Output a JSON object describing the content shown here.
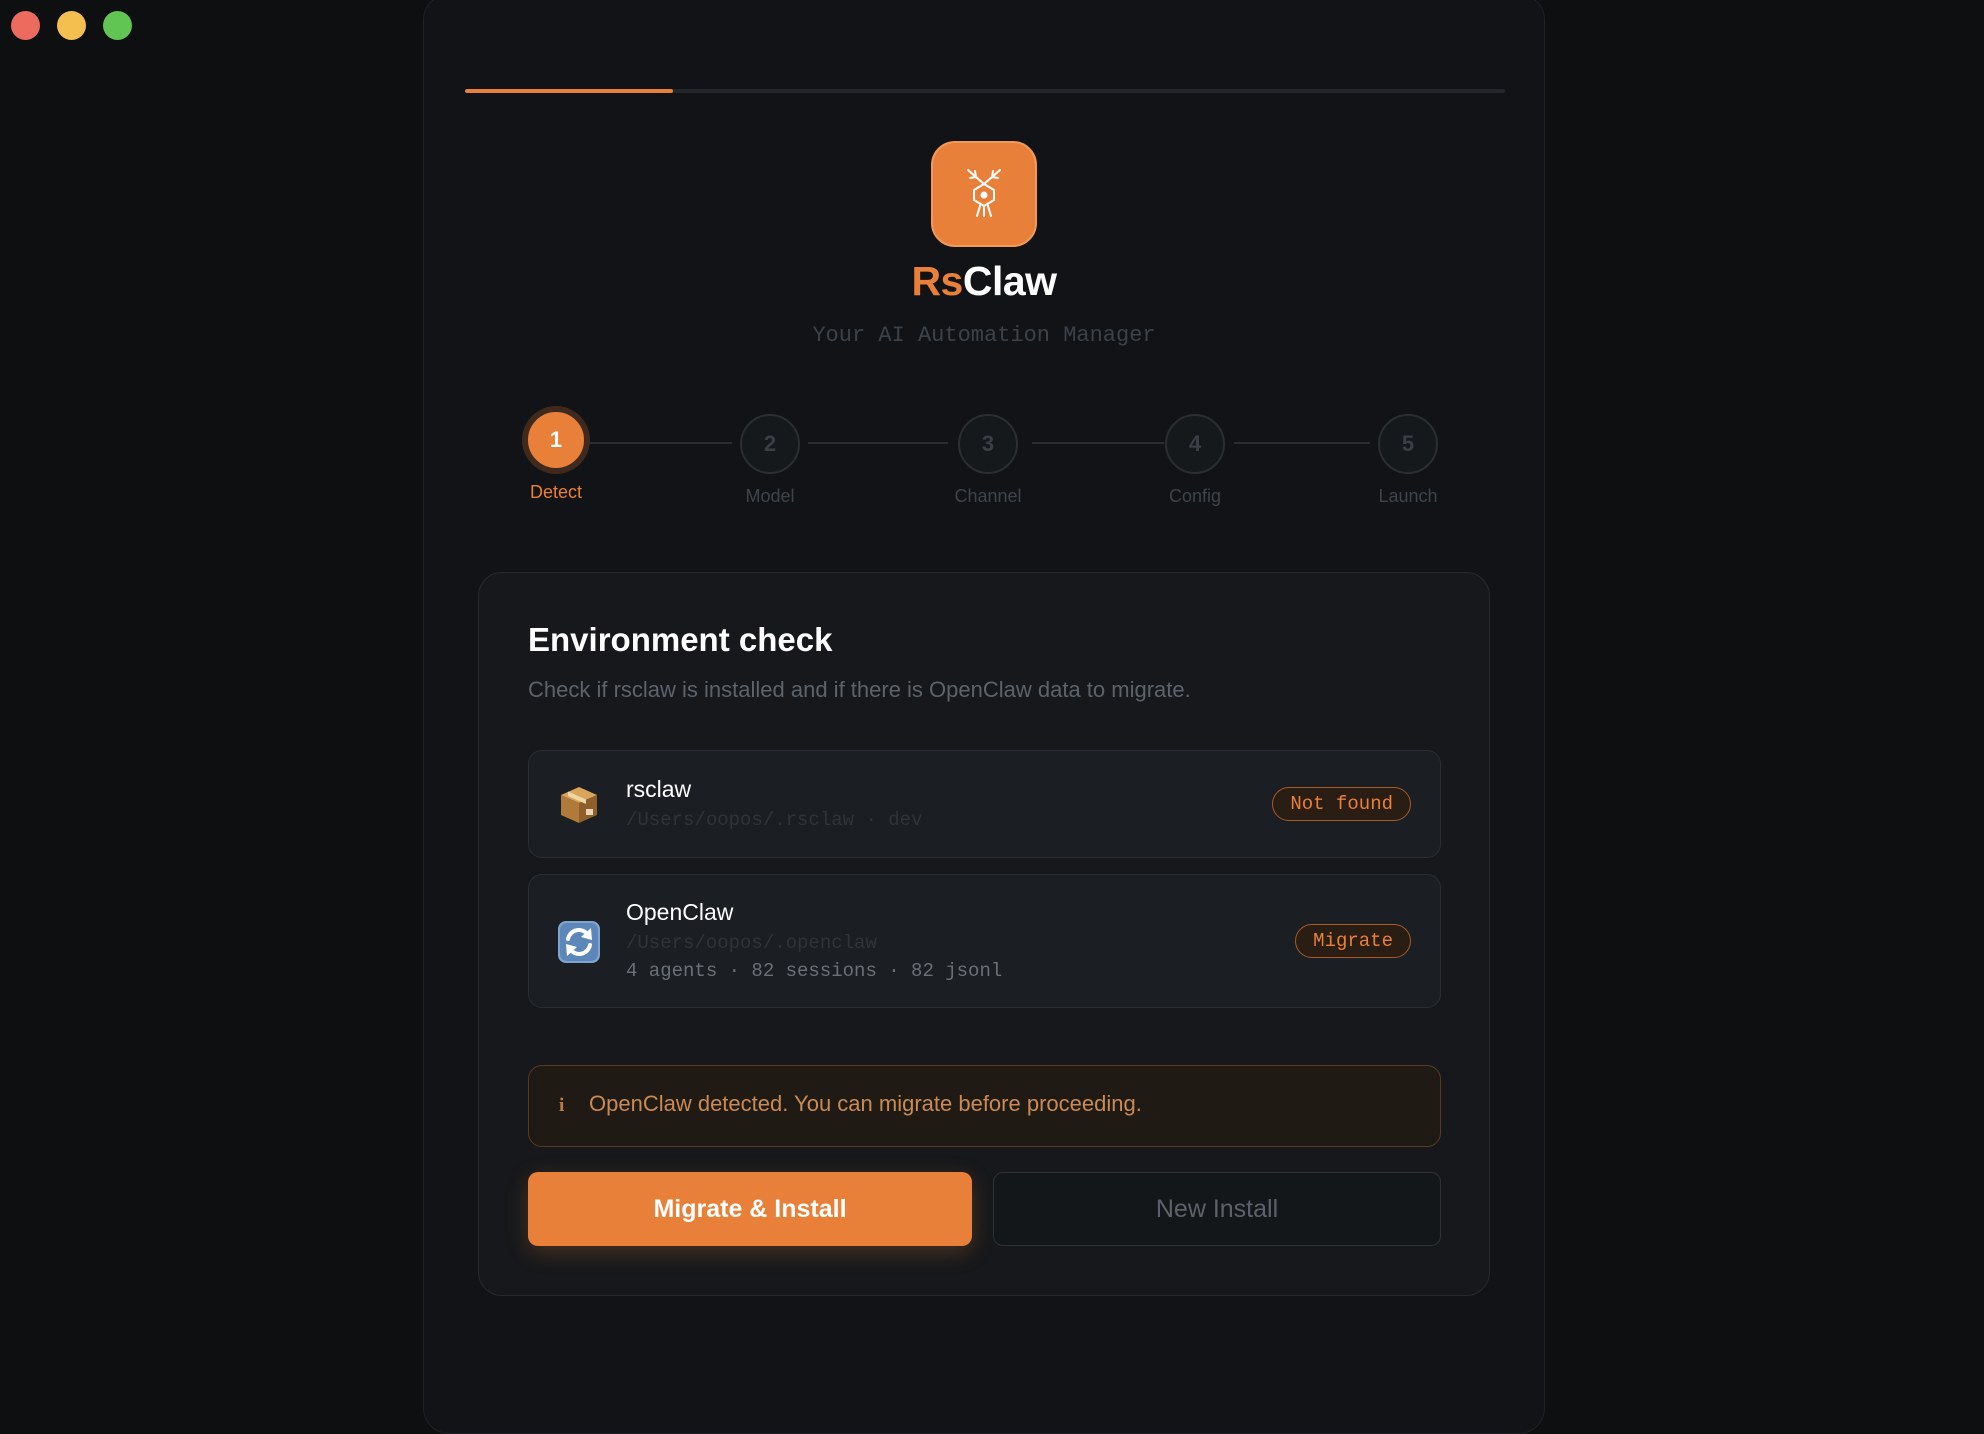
{
  "window": {
    "controls": [
      "close",
      "minimize",
      "maximize"
    ]
  },
  "progress": {
    "fraction": 0.2
  },
  "brand": {
    "name_accent": "Rs",
    "name_rest": "Claw",
    "tagline": "Your AI Automation Manager",
    "logo_icon": "antler-logo-icon"
  },
  "steps": [
    {
      "number": "1",
      "label": "Detect",
      "active": true
    },
    {
      "number": "2",
      "label": "Model",
      "active": false
    },
    {
      "number": "3",
      "label": "Channel",
      "active": false
    },
    {
      "number": "4",
      "label": "Config",
      "active": false
    },
    {
      "number": "5",
      "label": "Launch",
      "active": false
    }
  ],
  "card": {
    "title": "Environment check",
    "description": "Check if rsclaw is installed and if there is OpenClaw data to migrate.",
    "items": [
      {
        "icon": "package-icon",
        "name": "rsclaw",
        "path": "/Users/oopos/.rsclaw · dev",
        "stats": "",
        "badge": "Not found"
      },
      {
        "icon": "sync-icon",
        "name": "OpenClaw",
        "path": "/Users/oopos/.openclaw",
        "stats": "4 agents · 82 sessions · 82 jsonl",
        "badge": "Migrate"
      }
    ],
    "notice": {
      "icon": "info-icon",
      "text": "OpenClaw detected. You can migrate before proceeding."
    },
    "buttons": {
      "primary": "Migrate & Install",
      "secondary": "New Install"
    }
  },
  "colors": {
    "accent": "#e8803a",
    "background": "#0d0f11",
    "card": "#16181b"
  }
}
